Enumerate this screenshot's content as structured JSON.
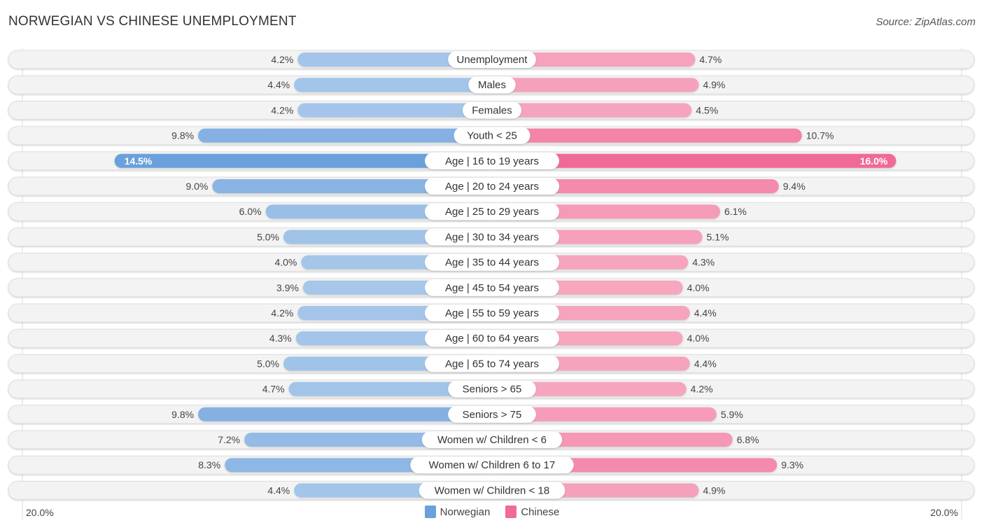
{
  "header": {
    "title": "NORWEGIAN VS CHINESE UNEMPLOYMENT",
    "source": "Source: ZipAtlas.com"
  },
  "axis": {
    "left_label": "20.0%",
    "right_label": "20.0%"
  },
  "legend": [
    {
      "name": "Norwegian",
      "color": "#6aa0dc"
    },
    {
      "name": "Chinese",
      "color": "#f06a96"
    }
  ],
  "chart_data": {
    "type": "bar",
    "orientation": "horizontal-diverging",
    "title": "NORWEGIAN VS CHINESE UNEMPLOYMENT",
    "xlabel": "",
    "ylabel": "",
    "xlim": [
      -20,
      20
    ],
    "legend_position": "bottom-center",
    "categories": [
      "Unemployment",
      "Males",
      "Females",
      "Youth < 25",
      "Age | 16 to 19 years",
      "Age | 20 to 24 years",
      "Age | 25 to 29 years",
      "Age | 30 to 34 years",
      "Age | 35 to 44 years",
      "Age | 45 to 54 years",
      "Age | 55 to 59 years",
      "Age | 60 to 64 years",
      "Age | 65 to 74 years",
      "Seniors > 65",
      "Seniors > 75",
      "Women w/ Children < 6",
      "Women w/ Children 6 to 17",
      "Women w/ Children < 18"
    ],
    "series": [
      {
        "name": "Norwegian",
        "color": "#6aa0dc",
        "values": [
          4.2,
          4.4,
          4.2,
          9.8,
          14.5,
          9.0,
          6.0,
          5.0,
          4.0,
          3.9,
          4.2,
          4.3,
          5.0,
          4.7,
          9.8,
          7.2,
          8.3,
          4.4
        ]
      },
      {
        "name": "Chinese",
        "color": "#f06a96",
        "values": [
          4.7,
          4.9,
          4.5,
          10.7,
          16.0,
          9.4,
          6.1,
          5.1,
          4.3,
          4.0,
          4.4,
          4.0,
          4.4,
          4.2,
          5.9,
          6.8,
          9.3,
          4.9
        ]
      }
    ],
    "value_labels_suffix": "%"
  }
}
